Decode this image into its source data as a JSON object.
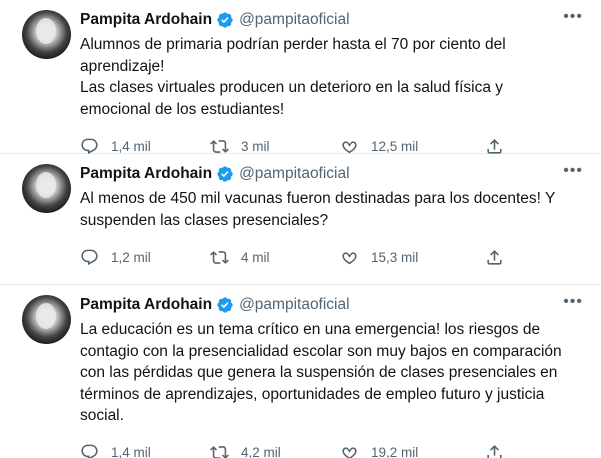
{
  "tweets": [
    {
      "name": "Pampita Ardohain",
      "handle": "@pampitaoficial",
      "text": "Alumnos de primaria podrían perder hasta el 70 por ciento del aprendizaje!\nLas clases virtuales producen un deterioro en la salud física y emocional de los estudiantes!",
      "replies": "1,4 mil",
      "retweets": "3 mil",
      "likes": "12,5 mil"
    },
    {
      "name": "Pampita Ardohain",
      "handle": "@pampitaoficial",
      "text": "Al menos de 450 mil vacunas fueron destinadas para los docentes! Y suspenden las clases presenciales?",
      "replies": "1,2 mil",
      "retweets": "4 mil",
      "likes": "15,3 mil"
    },
    {
      "name": "Pampita Ardohain",
      "handle": "@pampitaoficial",
      "text": "La educación es un tema crítico en una emergencia! los riesgos de contagio con la presencialidad escolar son muy bajos en comparación con las pérdidas que genera la suspensión de clases presenciales en términos de aprendizajes, oportunidades de empleo futuro y justicia social.",
      "replies": "1,4 mil",
      "retweets": "4,2 mil",
      "likes": "19,2 mil"
    }
  ],
  "icons": {
    "more": "more-icon",
    "verified": "verified-badge-icon",
    "reply": "reply-icon",
    "retweet": "retweet-icon",
    "like": "heart-icon",
    "share": "share-icon"
  },
  "colors": {
    "text": "#0f1419",
    "secondary": "#536471",
    "verified": "#1d9bf0",
    "divider": "#e6ecf0"
  }
}
